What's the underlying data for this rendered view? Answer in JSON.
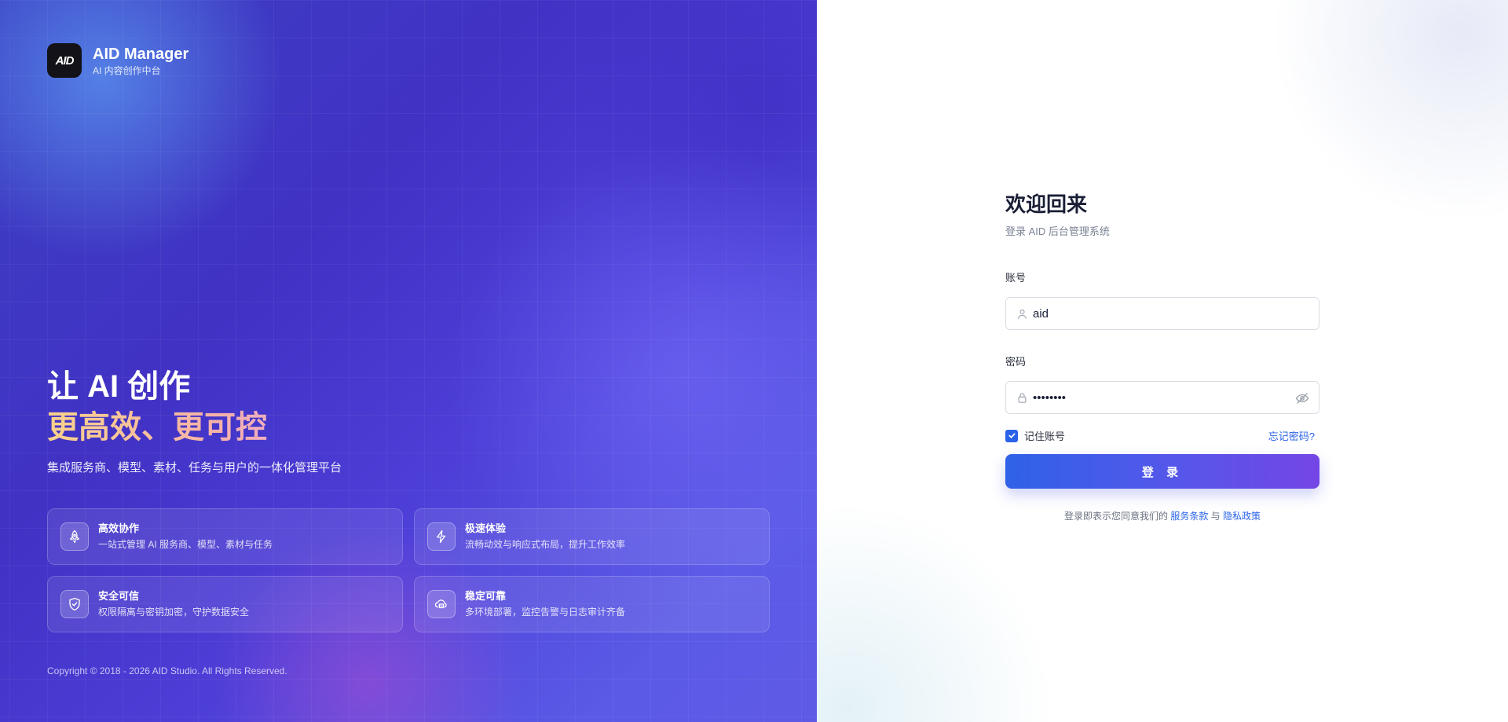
{
  "brand": {
    "logo_text": "AID",
    "name": "AID Manager",
    "subtitle": "AI 内容创作中台"
  },
  "hero": {
    "line1": "让 AI 创作",
    "line2": "更高效、更可控",
    "description": "集成服务商、模型、素材、任务与用户的一体化管理平台"
  },
  "features": [
    {
      "icon": "rocket-icon",
      "title": "高效协作",
      "desc": "一站式管理 AI 服务商、模型、素材与任务"
    },
    {
      "icon": "lightning-icon",
      "title": "极速体验",
      "desc": "流畅动效与响应式布局，提升工作效率"
    },
    {
      "icon": "shield-check-icon",
      "title": "安全可信",
      "desc": "权限隔离与密钥加密，守护数据安全"
    },
    {
      "icon": "cloud-server-icon",
      "title": "稳定可靠",
      "desc": "多环境部署，监控告警与日志审计齐备"
    }
  ],
  "copyright": "Copyright © 2018 - 2026 AID Studio. All Rights Reserved.",
  "login": {
    "title": "欢迎回来",
    "subtitle": "登录 AID 后台管理系统",
    "account_label": "账号",
    "account_value": "aid",
    "password_label": "密码",
    "password_value": "aid12345",
    "remember_label": "记住账号",
    "remember_checked": true,
    "forgot_label": "忘记密码?",
    "submit_label": "登 录",
    "terms_prefix": "登录即表示您同意我们的",
    "terms_link": "服务条款",
    "terms_and": "与",
    "privacy_link": "隐私政策"
  },
  "colors": {
    "accent": "#2a63e8",
    "panel_gradient_start": "#3b3fc2",
    "panel_gradient_end": "#5f5ae6",
    "button_gradient_start": "#2f62e8",
    "button_gradient_end": "#7446e6"
  }
}
